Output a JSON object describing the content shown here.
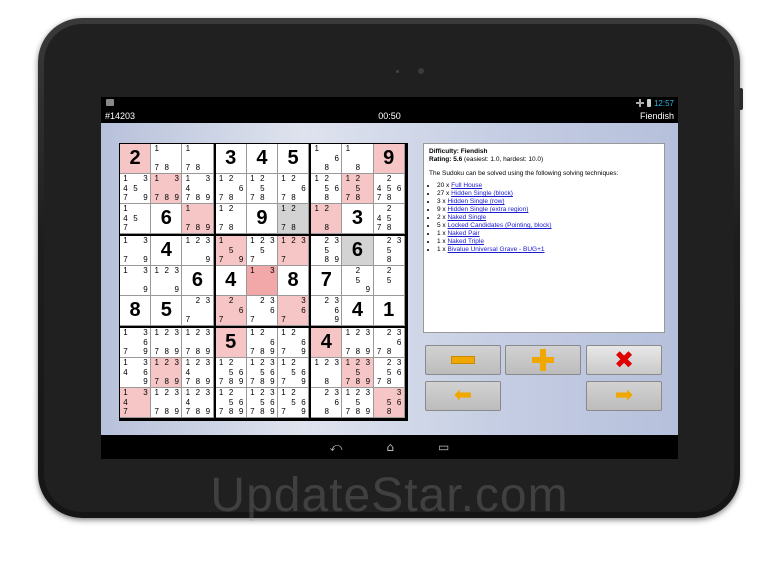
{
  "status": {
    "time": "12:57"
  },
  "title": {
    "id": "#14203",
    "timer": "00:50",
    "level": "Fiendish"
  },
  "grid": [
    [
      {
        "v": "2",
        "bg": "red"
      },
      {
        "c": "178"
      },
      {
        "c": "178"
      },
      {
        "v": "3"
      },
      {
        "v": "4"
      },
      {
        "v": "5"
      },
      {
        "c": "1 6 8"
      },
      {
        "c": "1 8"
      },
      {
        "v": "9",
        "bg": "red"
      }
    ],
    [
      {
        "c": "13 45 79"
      },
      {
        "c": "13 789",
        "bg": "red"
      },
      {
        "c": "13 4 789"
      },
      {
        "c": "12 6 78"
      },
      {
        "c": "12 5 78"
      },
      {
        "c": "12 6 78"
      },
      {
        "c": "12 56 8"
      },
      {
        "c": "12 5 78",
        "bg": "red"
      },
      {
        "c": "2 456 78"
      }
    ],
    [
      {
        "c": "1 45 7"
      },
      {
        "v": "6"
      },
      {
        "c": "1 789",
        "bg": "red"
      },
      {
        "c": "12 78"
      },
      {
        "v": "9"
      },
      {
        "c": "12 78",
        "bg": "gray"
      },
      {
        "c": "12 8",
        "bg": "red"
      },
      {
        "v": "3"
      },
      {
        "c": "2 45 78"
      }
    ],
    [
      {
        "c": "13 79"
      },
      {
        "v": "4"
      },
      {
        "c": "123 9"
      },
      {
        "c": "1 5 79",
        "bg": "red"
      },
      {
        "c": "123 5 7"
      },
      {
        "c": "123 7",
        "bg": "red"
      },
      {
        "c": "23 5 89"
      },
      {
        "v": "6",
        "bg": "gray"
      },
      {
        "c": "23 5 8"
      }
    ],
    [
      {
        "c": "13 9"
      },
      {
        "c": "123 9"
      },
      {
        "v": "6"
      },
      {
        "v": "4"
      },
      {
        "c": "13",
        "bg": "redstrong"
      },
      {
        "v": "8"
      },
      {
        "v": "7"
      },
      {
        "c": "2 5 9"
      },
      {
        "c": "2 5"
      }
    ],
    [
      {
        "v": "8"
      },
      {
        "v": "5"
      },
      {
        "c": "23 7"
      },
      {
        "c": "2 6 7",
        "bg": "red"
      },
      {
        "c": "23 6 7"
      },
      {
        "c": "3 6 7",
        "bg": "red"
      },
      {
        "c": "23 6 9"
      },
      {
        "v": "4"
      },
      {
        "v": "1"
      }
    ],
    [
      {
        "c": "13 6 79"
      },
      {
        "c": "123 789"
      },
      {
        "c": "123 789"
      },
      {
        "v": "5",
        "bg": "red"
      },
      {
        "c": "12 6 789"
      },
      {
        "c": "12 6 79"
      },
      {
        "v": "4",
        "bg": "red"
      },
      {
        "c": "123 789"
      },
      {
        "c": "23 6 78"
      }
    ],
    [
      {
        "c": "13 4 6 9"
      },
      {
        "c": "123 789",
        "bg": "red"
      },
      {
        "c": "123 4 789"
      },
      {
        "c": "12 56 789"
      },
      {
        "c": "123 56 789"
      },
      {
        "c": "12 56 79"
      },
      {
        "c": "123 8"
      },
      {
        "c": "123 5 789",
        "bg": "red"
      },
      {
        "c": "23 56 78"
      }
    ],
    [
      {
        "c": "13 4 7",
        "bg": "red"
      },
      {
        "c": "123 789"
      },
      {
        "c": "123 4 789"
      },
      {
        "c": "12 56 789"
      },
      {
        "c": "123 56 789"
      },
      {
        "c": "12 56 79"
      },
      {
        "c": "23 6 8"
      },
      {
        "c": "123 5 789"
      },
      {
        "c": "3 56 8",
        "bg": "red"
      }
    ]
  ],
  "info": {
    "difficulty": "Difficulty: Fiendish",
    "rating_label": "Rating: 5.6",
    "rating_note": "(easiest: 1.0, hardest: 10.0)",
    "intro": "The Sudoku can be solved using the following solving techniques:",
    "techniques": [
      {
        "count": "20 x",
        "name": "Full House"
      },
      {
        "count": "27 x",
        "name": "Hidden Single (block)"
      },
      {
        "count": "3 x",
        "name": "Hidden Single (row)"
      },
      {
        "count": "9 x",
        "name": "Hidden Single (extra region)"
      },
      {
        "count": "2 x",
        "name": "Naked Single"
      },
      {
        "count": "5 x",
        "name": "Locked Candidates (Pointing, block)"
      },
      {
        "count": "1 x",
        "name": "Naked Pair"
      },
      {
        "count": "1 x",
        "name": "Naked Triple"
      },
      {
        "count": "1 x",
        "name": "Bivalue Universal Grave - BUG+1"
      }
    ]
  },
  "buttons": {
    "minus_icon": "minus-icon",
    "plus_icon": "plus-icon",
    "close_icon": "close-icon",
    "back_icon": "arrow-left-icon",
    "forward_icon": "arrow-right-icon",
    "x_glyph": "✖",
    "left_glyph": "⬅",
    "right_glyph": "➡"
  },
  "nav": {
    "back": "⤺",
    "home": "⌂",
    "recents": "▭"
  },
  "watermark": "UpdateStar.com",
  "colors": {
    "red": "#f6c6c6",
    "redstrong": "#f2a8a8",
    "gray": "#d3d3d3",
    "accent": "#f0a800",
    "close": "#e00000"
  }
}
